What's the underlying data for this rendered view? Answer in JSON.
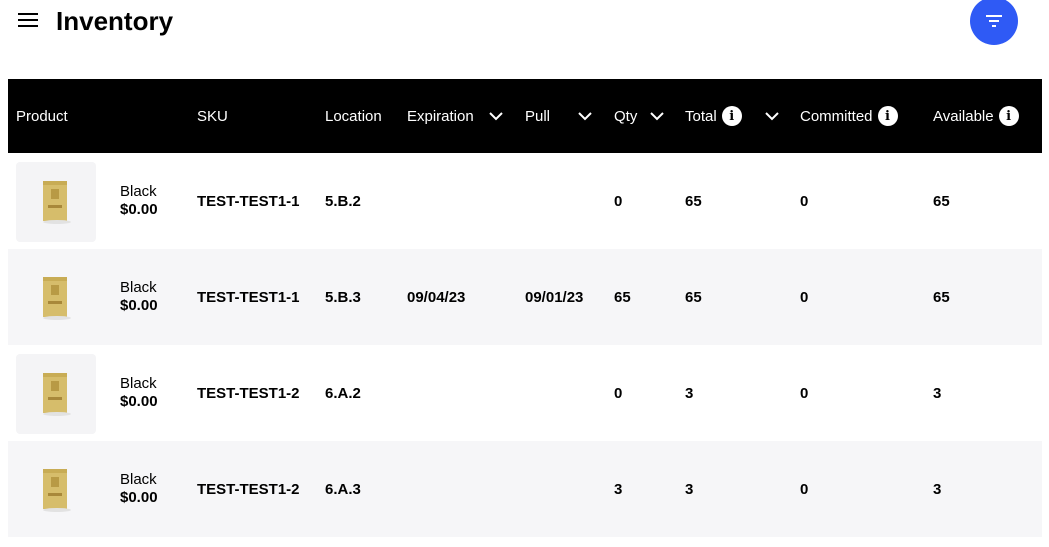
{
  "header": {
    "title": "Inventory",
    "menu_icon": "hamburger-menu-icon",
    "filter_icon": "filter-icon",
    "accent": "#2f5af5"
  },
  "columns": [
    {
      "label": "Product"
    },
    {
      "label": "SKU"
    },
    {
      "label": "Location"
    },
    {
      "label": "Expiration"
    },
    {
      "label": "Pull"
    },
    {
      "label": "Qty"
    },
    {
      "label": "Total"
    },
    {
      "label": "Committed"
    },
    {
      "label": "Available"
    }
  ],
  "rows": [
    {
      "name": "Black",
      "price": "$0.00",
      "sku": "TEST-TEST1-1",
      "location": "5.B.2",
      "expiration": "",
      "pull": "",
      "qty": "0",
      "total": "65",
      "committed": "0",
      "available": "65"
    },
    {
      "name": "Black",
      "price": "$0.00",
      "sku": "TEST-TEST1-1",
      "location": "5.B.3",
      "expiration": "09/04/23",
      "pull": "09/01/23",
      "qty": "65",
      "total": "65",
      "committed": "0",
      "available": "65"
    },
    {
      "name": "Black",
      "price": "$0.00",
      "sku": "TEST-TEST1-2",
      "location": "6.A.2",
      "expiration": "",
      "pull": "",
      "qty": "0",
      "total": "3",
      "committed": "0",
      "available": "3"
    },
    {
      "name": "Black",
      "price": "$0.00",
      "sku": "TEST-TEST1-2",
      "location": "6.A.3",
      "expiration": "",
      "pull": "",
      "qty": "3",
      "total": "3",
      "committed": "0",
      "available": "3"
    }
  ]
}
